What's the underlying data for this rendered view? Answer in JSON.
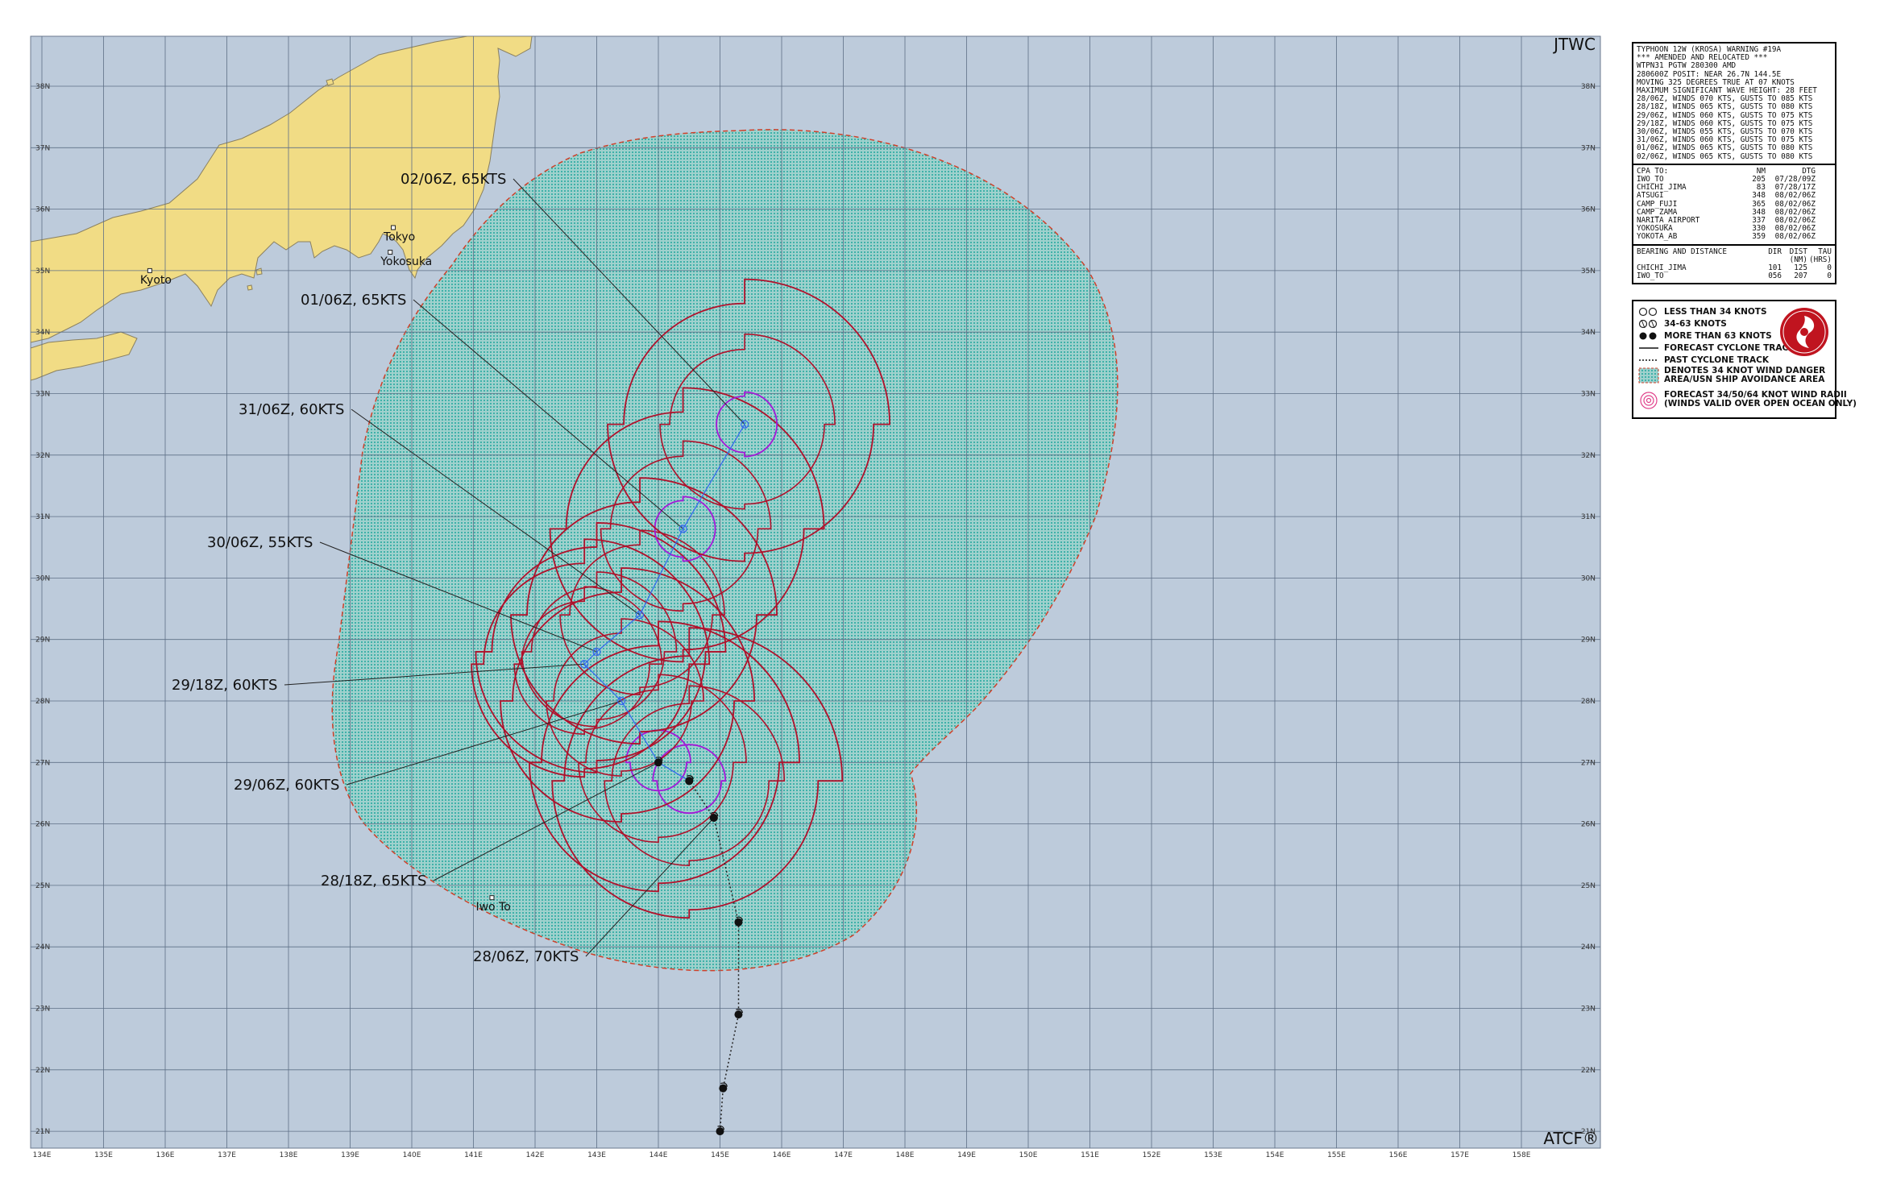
{
  "corner": {
    "top_right": "JTWC",
    "bottom_right": "ATCF®"
  },
  "axes": {
    "lon_labels": [
      "134E",
      "135E",
      "136E",
      "137E",
      "138E",
      "139E",
      "140E",
      "141E",
      "142E",
      "143E",
      "144E",
      "145E",
      "146E",
      "147E",
      "148E",
      "149E",
      "150E",
      "151E",
      "152E",
      "153E",
      "154E",
      "155E",
      "156E",
      "157E",
      "158E"
    ],
    "lat_labels": [
      "38N",
      "37N",
      "36N",
      "35N",
      "34N",
      "33N",
      "32N",
      "31N",
      "30N",
      "29N",
      "28N",
      "27N",
      "26N",
      "25N",
      "24N",
      "23N",
      "22N",
      "21N"
    ]
  },
  "colors": {
    "ocean": "#bdcbdb",
    "land": "#f1dc85",
    "danger_area": "#3fb1a9",
    "wind34": "#b0112b",
    "wind64": "#a418d8",
    "track": "#3366ee",
    "grid": "#5e6f86"
  },
  "cities": [
    {
      "name": "Kyoto",
      "lon": 135.75,
      "lat": 35.0
    },
    {
      "name": "Tokyo",
      "lon": 139.7,
      "lat": 35.7
    },
    {
      "name": "Yokosuka",
      "lon": 139.65,
      "lat": 35.3
    },
    {
      "name": "Iwo To",
      "lon": 141.3,
      "lat": 24.8
    }
  ],
  "forecast_labels": [
    {
      "text": "02/06Z,  65KTS",
      "lat": 32.5,
      "lon": 145.4
    },
    {
      "text": "01/06Z,  65KTS",
      "lat": 30.8,
      "lon": 144.4
    },
    {
      "text": "31/06Z,  60KTS",
      "lat": 29.4,
      "lon": 143.7
    },
    {
      "text": "30/06Z,  55KTS",
      "lat": 28.8,
      "lon": 143.0
    },
    {
      "text": "29/18Z,  60KTS",
      "lat": 28.6,
      "lon": 142.8
    },
    {
      "text": "29/06Z,  60KTS",
      "lat": 28.0,
      "lon": 143.4
    },
    {
      "text": "28/18Z,  65KTS",
      "lat": 27.0,
      "lon": 144.0
    },
    {
      "text": "28/06Z,  70KTS",
      "lat": 26.1,
      "lon": 144.9
    }
  ],
  "past_track": [
    {
      "lat": 21.0,
      "lon": 145.0,
      "cat": "more_than_63"
    },
    {
      "lat": 21.7,
      "lon": 145.05,
      "cat": "more_than_63"
    },
    {
      "lat": 22.9,
      "lon": 145.3,
      "cat": "more_than_63"
    },
    {
      "lat": 24.4,
      "lon": 145.3,
      "cat": "more_than_63"
    },
    {
      "lat": 26.1,
      "lon": 144.9,
      "cat": "more_than_63"
    },
    {
      "lat": 26.7,
      "lon": 144.5,
      "cat": "more_than_63"
    }
  ],
  "forecast_track": [
    {
      "lat": 26.7,
      "lon": 144.5,
      "cat": "more_than_63"
    },
    {
      "lat": 27.0,
      "lon": 144.0,
      "cat": "more_than_63"
    },
    {
      "lat": 28.0,
      "lon": 143.4,
      "cat": "34_63"
    },
    {
      "lat": 28.6,
      "lon": 142.8,
      "cat": "34_63"
    },
    {
      "lat": 28.8,
      "lon": 143.0,
      "cat": "34_63"
    },
    {
      "lat": 29.4,
      "lon": 143.7,
      "cat": "34_63"
    },
    {
      "lat": 30.8,
      "lon": 144.4,
      "cat": "34_63"
    },
    {
      "lat": 32.5,
      "lon": 145.4,
      "cat": "34_63"
    }
  ],
  "info_box": {
    "header": [
      "TYPHOON 12W (KROSA) WARNING #19A",
      "*** AMENDED AND RELOCATED ***",
      "WTPN31 PGTW 280300 AMD",
      "280600Z POSIT: NEAR 26.7N 144.5E",
      "MOVING 325 DEGREES TRUE AT 07 KNOTS",
      "MAXIMUM SIGNIFICANT WAVE HEIGHT: 28 FEET",
      "28/06Z, WINDS 070 KTS, GUSTS TO 085 KTS",
      "28/18Z, WINDS 065 KTS, GUSTS TO 080 KTS",
      "29/06Z, WINDS 060 KTS, GUSTS TO 075 KTS",
      "29/18Z, WINDS 060 KTS, GUSTS TO 075 KTS",
      "30/06Z, WINDS 055 KTS, GUSTS TO 070 KTS",
      "31/06Z, WINDS 060 KTS, GUSTS TO 075 KTS",
      "01/06Z, WINDS 065 KTS, GUSTS TO 080 KTS",
      "02/06Z, WINDS 065 KTS, GUSTS TO 080 KTS"
    ],
    "cpa_header": [
      "CPA TO:",
      "NM",
      "DTG"
    ],
    "cpa_rows": [
      [
        "IWO_TO",
        "205",
        "07/28/09Z"
      ],
      [
        "CHICHI_JIMA",
        "83",
        "07/28/17Z"
      ],
      [
        "ATSUGI",
        "348",
        "08/02/06Z"
      ],
      [
        "CAMP_FUJI",
        "365",
        "08/02/06Z"
      ],
      [
        "CAMP_ZAMA",
        "348",
        "08/02/06Z"
      ],
      [
        "NARITA_AIRPORT",
        "337",
        "08/02/06Z"
      ],
      [
        "YOKOSUKA",
        "330",
        "08/02/06Z"
      ],
      [
        "YOKOTA_AB",
        "359",
        "08/02/06Z"
      ]
    ],
    "bearing_header": [
      "BEARING AND DISTANCE",
      "DIR",
      "DIST",
      "TAU"
    ],
    "bearing_units": [
      "",
      "",
      "(NM)",
      "(HRS)"
    ],
    "bearing_rows": [
      [
        "CHICHI_JIMA",
        "101",
        "125",
        "0"
      ],
      [
        "IWO_TO",
        "056",
        "207",
        "0"
      ]
    ]
  },
  "legend": {
    "items": [
      "LESS THAN 34 KNOTS",
      "34-63 KNOTS",
      "MORE THAN 63 KNOTS",
      "FORECAST CYCLONE TRACK",
      "PAST CYCLONE TRACK",
      "DENOTES 34 KNOT WIND DANGER",
      "AREA/USN SHIP AVOIDANCE AREA",
      "FORECAST 34/50/64 KNOT WIND RADII",
      "(WINDS VALID OVER OPEN OCEAN ONLY)"
    ]
  }
}
